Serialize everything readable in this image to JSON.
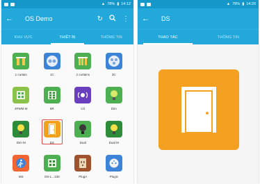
{
  "left_screen": {
    "status": {
      "time": "14:12",
      "battery": "78%"
    },
    "title": "OS Demo",
    "tabs": [
      {
        "label": "KHU VỰC",
        "active": false
      },
      {
        "label": "THIẾT BỊ",
        "active": true
      },
      {
        "label": "THÔNG TIN",
        "active": false
      }
    ],
    "devices": [
      {
        "label": "1 curtain",
        "icon": "curtain-icon",
        "color": "#4caf50"
      },
      {
        "label": "1C",
        "icon": "two-switch-icon",
        "color": "#3b84d8"
      },
      {
        "label": "2 curtains",
        "icon": "curtain-icon",
        "color": "#4caf50"
      },
      {
        "label": "3C",
        "icon": "three-switch-icon",
        "color": "#3b84d8"
      },
      {
        "label": "4PWM M",
        "icon": "switch-panel-icon",
        "color": "#8bc34a"
      },
      {
        "label": "6R",
        "icon": "switch-panel-icon",
        "color": "#4caf50"
      },
      {
        "label": "C0",
        "icon": "sensor-icon",
        "color": "#6a3fbf"
      },
      {
        "label": "Dim",
        "icon": "bulb-icon",
        "color": "#4caf50"
      },
      {
        "label": "Dim M",
        "icon": "bulb-icon",
        "color": "#2e8b3a"
      },
      {
        "label": "DS",
        "icon": "door-icon",
        "color": "#f2a11d",
        "selected": true
      },
      {
        "label": "Dual",
        "icon": "bulb-icon",
        "color": "#4caf50"
      },
      {
        "label": "Dual M",
        "icon": "bulb-icon",
        "color": "#2e8b3a"
      },
      {
        "label": "MS",
        "icon": "motion-sensor-icon",
        "color": "#f26533"
      },
      {
        "label": "OS-L...130",
        "icon": "switch-panel-icon",
        "color": "#4caf50"
      },
      {
        "label": "PlugA",
        "icon": "plug-icon",
        "color": "#a0522d"
      },
      {
        "label": "PlugS",
        "icon": "plug-icon",
        "color": "#3b84d8"
      }
    ]
  },
  "right_screen": {
    "status": {
      "time": "14:20",
      "battery": "78%"
    },
    "title": "DS",
    "tabs": [
      {
        "label": "THAO TÁC",
        "active": true
      },
      {
        "label": "THÔNG TIN",
        "active": false
      }
    ],
    "device_icon": "door-icon",
    "device_color": "#f4a020"
  }
}
